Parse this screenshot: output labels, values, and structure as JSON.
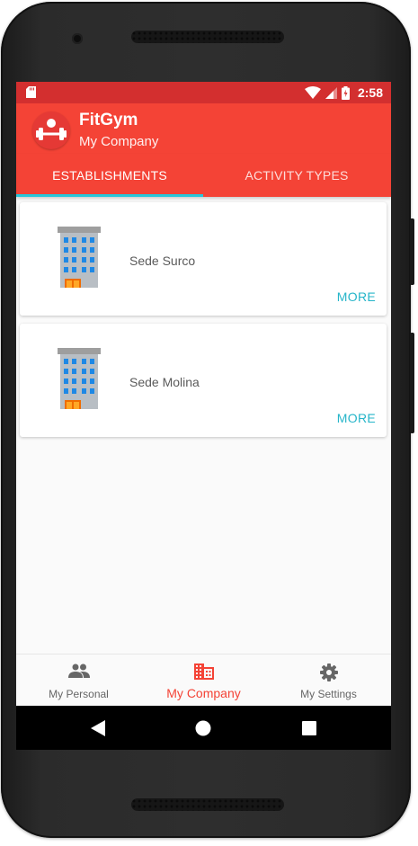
{
  "status_bar": {
    "time": "2:58"
  },
  "app_bar": {
    "title": "FitGym",
    "subtitle": "My Company"
  },
  "tabs": [
    {
      "label": "ESTABLISHMENTS",
      "selected": true
    },
    {
      "label": "ACTIVITY TYPES",
      "selected": false
    }
  ],
  "establishments": [
    {
      "name": "Sede Surco",
      "action": "MORE",
      "icon": "building-icon"
    },
    {
      "name": "Sede Molina",
      "action": "MORE",
      "icon": "building-icon"
    }
  ],
  "fab": {
    "icon": "plus-icon",
    "label": "+"
  },
  "bottom_nav": [
    {
      "label": "My Personal",
      "icon": "people-icon",
      "active": false
    },
    {
      "label": "My Company",
      "icon": "domain-icon",
      "active": true
    },
    {
      "label": "My Settings",
      "icon": "gear-icon",
      "active": false
    }
  ],
  "colors": {
    "primary": "#f44336",
    "primary_dark": "#d32f2f",
    "accent": "#00bcd4",
    "link": "#26b5c9"
  }
}
